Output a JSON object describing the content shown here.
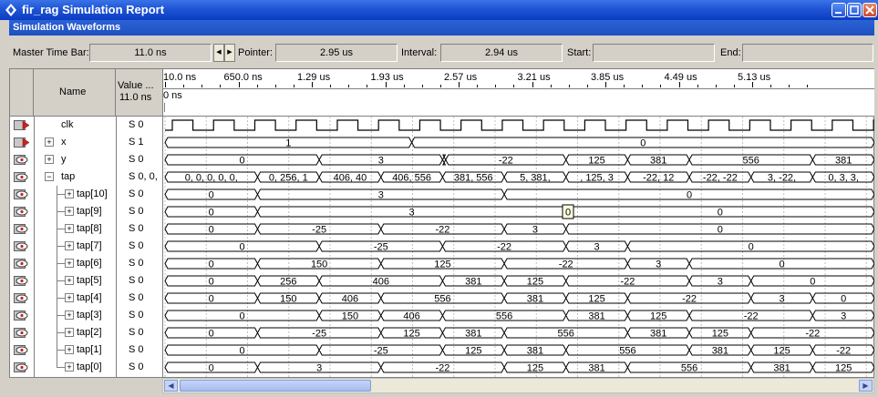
{
  "window": {
    "title": "fir_rag Simulation Report"
  },
  "section": {
    "title": "Simulation Waveforms"
  },
  "infobar": {
    "master_time_bar_label": "Master Time Bar:",
    "master_time_bar_value": "11.0 ns",
    "pointer_label": "Pointer:",
    "pointer_value": "2.95 us",
    "interval_label": "Interval:",
    "interval_value": "2.94 us",
    "start_label": "Start:",
    "start_value": "",
    "end_label": "End:",
    "end_value": ""
  },
  "columns": {
    "name": "Name",
    "value": "Value ...",
    "value_time": "11.0 ns"
  },
  "timeline": {
    "ticks": [
      "10.0 ns",
      "650.0 ns",
      "1.29 us",
      "1.93 us",
      "2.57 us",
      "3.21 us",
      "3.85 us",
      "4.49 us",
      "5.13 us"
    ],
    "cursor_label": "0 ns"
  },
  "signals": [
    {
      "name": "clk",
      "value": "S 0",
      "kind": "clock",
      "icon": "input-pin-icon",
      "expander": ""
    },
    {
      "name": "x",
      "value": "S 1",
      "kind": "bus",
      "icon": "input-pin-icon",
      "expander": "+",
      "segments": [
        {
          "s": 0,
          "e": 400,
          "v": "1"
        },
        {
          "s": 400,
          "e": 1150,
          "v": "0"
        }
      ]
    },
    {
      "name": "y",
      "value": "S 0",
      "kind": "bus",
      "icon": "output-pin-icon",
      "expander": "+",
      "segments": [
        {
          "s": 0,
          "e": 250,
          "v": "0"
        },
        {
          "s": 250,
          "e": 450,
          "v": "3"
        },
        {
          "s": 450,
          "e": 455,
          "v": ""
        },
        {
          "s": 455,
          "e": 650,
          "v": "-22"
        },
        {
          "s": 650,
          "e": 750,
          "v": "125"
        },
        {
          "s": 750,
          "e": 850,
          "v": "381"
        },
        {
          "s": 850,
          "e": 1050,
          "v": "556"
        },
        {
          "s": 1050,
          "e": 1150,
          "v": "381"
        }
      ]
    },
    {
      "name": "tap",
      "value": "S 0, 0, ...",
      "kind": "bus",
      "icon": "output-pin-icon",
      "expander": "-",
      "segments": [
        {
          "s": 0,
          "e": 150,
          "v": "0, 0, 0, 0, 0,"
        },
        {
          "s": 150,
          "e": 250,
          "v": "0, 256, 1"
        },
        {
          "s": 250,
          "e": 350,
          "v": "406, 40"
        },
        {
          "s": 350,
          "e": 450,
          "v": "406, 556"
        },
        {
          "s": 450,
          "e": 550,
          "v": "381, 556"
        },
        {
          "s": 550,
          "e": 650,
          "v": "5, 381,"
        },
        {
          "s": 650,
          "e": 750,
          "v": ", 125, 3"
        },
        {
          "s": 750,
          "e": 850,
          "v": "-22, 12"
        },
        {
          "s": 850,
          "e": 950,
          "v": "-22, -22"
        },
        {
          "s": 950,
          "e": 1050,
          "v": "3, -22,"
        },
        {
          "s": 1050,
          "e": 1150,
          "v": "0, 3, 3,"
        }
      ]
    },
    {
      "name": "tap[10]",
      "value": "S 0",
      "kind": "bus",
      "icon": "output-pin-icon",
      "expander": "+",
      "segments": [
        {
          "s": 0,
          "e": 150,
          "v": "0"
        },
        {
          "s": 150,
          "e": 550,
          "v": "3"
        },
        {
          "s": 550,
          "e": 1150,
          "v": "0"
        }
      ]
    },
    {
      "name": "tap[9]",
      "value": "S 0",
      "kind": "bus",
      "icon": "output-pin-icon",
      "expander": "+",
      "segments": [
        {
          "s": 0,
          "e": 150,
          "v": "0"
        },
        {
          "s": 150,
          "e": 650,
          "v": "3"
        },
        {
          "s": 650,
          "e": 1150,
          "v": "0"
        }
      ]
    },
    {
      "name": "tap[8]",
      "value": "S 0",
      "kind": "bus",
      "icon": "output-pin-icon",
      "expander": "+",
      "segments": [
        {
          "s": 0,
          "e": 150,
          "v": "0"
        },
        {
          "s": 150,
          "e": 350,
          "v": "-25"
        },
        {
          "s": 350,
          "e": 550,
          "v": "-22"
        },
        {
          "s": 550,
          "e": 650,
          "v": "3"
        },
        {
          "s": 650,
          "e": 1150,
          "v": "0"
        }
      ]
    },
    {
      "name": "tap[7]",
      "value": "S 0",
      "kind": "bus",
      "icon": "output-pin-icon",
      "expander": "+",
      "segments": [
        {
          "s": 0,
          "e": 250,
          "v": "0"
        },
        {
          "s": 250,
          "e": 450,
          "v": "-25"
        },
        {
          "s": 450,
          "e": 650,
          "v": "-22"
        },
        {
          "s": 650,
          "e": 750,
          "v": "3"
        },
        {
          "s": 750,
          "e": 1150,
          "v": "0"
        }
      ]
    },
    {
      "name": "tap[6]",
      "value": "S 0",
      "kind": "bus",
      "icon": "output-pin-icon",
      "expander": "+",
      "segments": [
        {
          "s": 0,
          "e": 150,
          "v": "0"
        },
        {
          "s": 150,
          "e": 350,
          "v": "150"
        },
        {
          "s": 350,
          "e": 550,
          "v": "125"
        },
        {
          "s": 550,
          "e": 750,
          "v": "-22"
        },
        {
          "s": 750,
          "e": 850,
          "v": "3"
        },
        {
          "s": 850,
          "e": 1150,
          "v": "0"
        }
      ]
    },
    {
      "name": "tap[5]",
      "value": "S 0",
      "kind": "bus",
      "icon": "output-pin-icon",
      "expander": "+",
      "segments": [
        {
          "s": 0,
          "e": 150,
          "v": "0"
        },
        {
          "s": 150,
          "e": 250,
          "v": "256"
        },
        {
          "s": 250,
          "e": 450,
          "v": "406"
        },
        {
          "s": 450,
          "e": 550,
          "v": "381"
        },
        {
          "s": 550,
          "e": 650,
          "v": "125"
        },
        {
          "s": 650,
          "e": 850,
          "v": "-22"
        },
        {
          "s": 850,
          "e": 950,
          "v": "3"
        },
        {
          "s": 950,
          "e": 1150,
          "v": "0"
        }
      ]
    },
    {
      "name": "tap[4]",
      "value": "S 0",
      "kind": "bus",
      "icon": "output-pin-icon",
      "expander": "+",
      "segments": [
        {
          "s": 0,
          "e": 150,
          "v": "0"
        },
        {
          "s": 150,
          "e": 250,
          "v": "150"
        },
        {
          "s": 250,
          "e": 350,
          "v": "406"
        },
        {
          "s": 350,
          "e": 550,
          "v": "556"
        },
        {
          "s": 550,
          "e": 650,
          "v": "381"
        },
        {
          "s": 650,
          "e": 750,
          "v": "125"
        },
        {
          "s": 750,
          "e": 950,
          "v": "-22"
        },
        {
          "s": 950,
          "e": 1050,
          "v": "3"
        },
        {
          "s": 1050,
          "e": 1150,
          "v": "0"
        }
      ]
    },
    {
      "name": "tap[3]",
      "value": "S 0",
      "kind": "bus",
      "icon": "output-pin-icon",
      "expander": "+",
      "segments": [
        {
          "s": 0,
          "e": 250,
          "v": "0"
        },
        {
          "s": 250,
          "e": 350,
          "v": "150"
        },
        {
          "s": 350,
          "e": 450,
          "v": "406"
        },
        {
          "s": 450,
          "e": 650,
          "v": "556"
        },
        {
          "s": 650,
          "e": 750,
          "v": "381"
        },
        {
          "s": 750,
          "e": 850,
          "v": "125"
        },
        {
          "s": 850,
          "e": 1050,
          "v": "-22"
        },
        {
          "s": 1050,
          "e": 1150,
          "v": "3"
        }
      ]
    },
    {
      "name": "tap[2]",
      "value": "S 0",
      "kind": "bus",
      "icon": "output-pin-icon",
      "expander": "+",
      "segments": [
        {
          "s": 0,
          "e": 150,
          "v": "0"
        },
        {
          "s": 150,
          "e": 350,
          "v": "-25"
        },
        {
          "s": 350,
          "e": 450,
          "v": "125"
        },
        {
          "s": 450,
          "e": 550,
          "v": "381"
        },
        {
          "s": 550,
          "e": 750,
          "v": "556"
        },
        {
          "s": 750,
          "e": 850,
          "v": "381"
        },
        {
          "s": 850,
          "e": 950,
          "v": "125"
        },
        {
          "s": 950,
          "e": 1150,
          "v": "-22"
        }
      ]
    },
    {
      "name": "tap[1]",
      "value": "S 0",
      "kind": "bus",
      "icon": "output-pin-icon",
      "expander": "+",
      "segments": [
        {
          "s": 0,
          "e": 250,
          "v": "0"
        },
        {
          "s": 250,
          "e": 450,
          "v": "-25"
        },
        {
          "s": 450,
          "e": 550,
          "v": "125"
        },
        {
          "s": 550,
          "e": 650,
          "v": "381"
        },
        {
          "s": 650,
          "e": 850,
          "v": "556"
        },
        {
          "s": 850,
          "e": 950,
          "v": "381"
        },
        {
          "s": 950,
          "e": 1050,
          "v": "125"
        },
        {
          "s": 1050,
          "e": 1150,
          "v": "-22"
        }
      ]
    },
    {
      "name": "tap[0]",
      "value": "S 0",
      "kind": "bus",
      "icon": "output-pin-icon",
      "expander": "+",
      "segments": [
        {
          "s": 0,
          "e": 150,
          "v": "0"
        },
        {
          "s": 150,
          "e": 350,
          "v": "3"
        },
        {
          "s": 350,
          "e": 550,
          "v": "-22"
        },
        {
          "s": 550,
          "e": 650,
          "v": "125"
        },
        {
          "s": 650,
          "e": 750,
          "v": "381"
        },
        {
          "s": 750,
          "e": 950,
          "v": "556"
        },
        {
          "s": 950,
          "e": 1050,
          "v": "381"
        },
        {
          "s": 1050,
          "e": 1150,
          "v": "125"
        }
      ]
    }
  ],
  "tooltip": {
    "value": "0"
  },
  "colors": {
    "title_blue": "#1f55d4",
    "waveform": "#000000"
  }
}
